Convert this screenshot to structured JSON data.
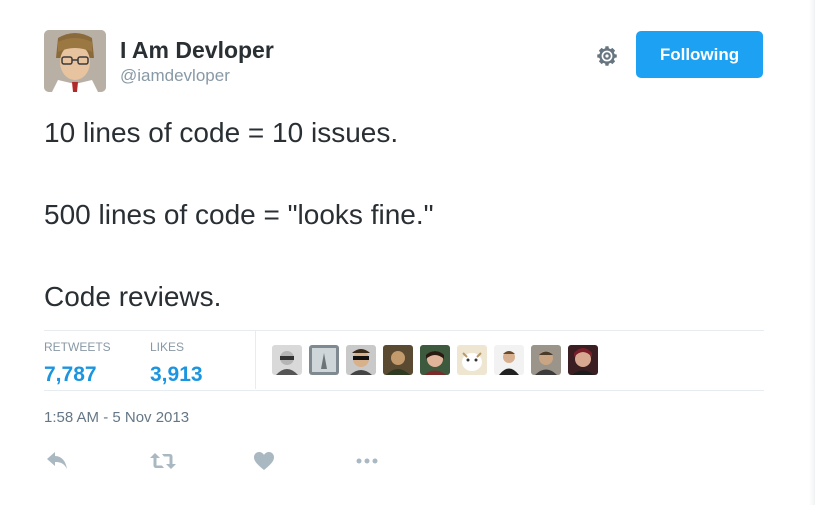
{
  "user": {
    "display_name": "I Am Devloper",
    "screen_name": "@iamdevloper",
    "avatar_icon": "user-avatar"
  },
  "follow_button": {
    "label": "Following",
    "color": "#1da1f2"
  },
  "tweet": {
    "lines": [
      "10 lines of code = 10 issues.",
      "500 lines of code = \"looks fine.\"",
      "Code reviews."
    ]
  },
  "stats": {
    "retweets_label": "RETWEETS",
    "retweets_value": "7,787",
    "likes_label": "LIKES",
    "likes_value": "3,913",
    "value_color": "#1b95e0"
  },
  "likers": [
    {
      "icon": "liker-avatar-1"
    },
    {
      "icon": "liker-avatar-2"
    },
    {
      "icon": "liker-avatar-3"
    },
    {
      "icon": "liker-avatar-4"
    },
    {
      "icon": "liker-avatar-5"
    },
    {
      "icon": "liker-avatar-6"
    },
    {
      "icon": "liker-avatar-7"
    },
    {
      "icon": "liker-avatar-8"
    },
    {
      "icon": "liker-avatar-9"
    }
  ],
  "timestamp": "1:58 AM - 5 Nov 2013",
  "actions": [
    {
      "icon": "reply-icon"
    },
    {
      "icon": "retweet-icon"
    },
    {
      "icon": "like-heart-icon"
    },
    {
      "icon": "more-dots-icon"
    }
  ]
}
